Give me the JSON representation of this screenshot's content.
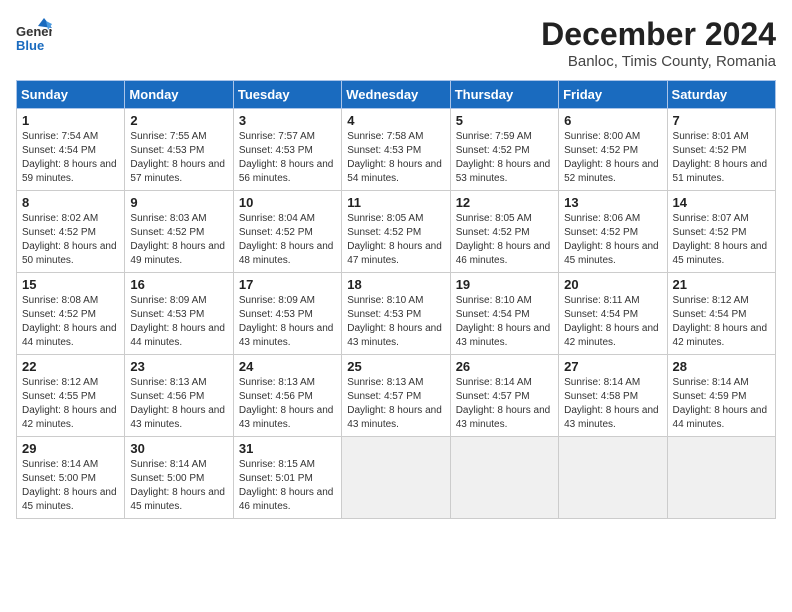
{
  "header": {
    "logo": {
      "line1": "General",
      "line2": "Blue"
    },
    "title": "December 2024",
    "subtitle": "Banloc, Timis County, Romania"
  },
  "weekdays": [
    "Sunday",
    "Monday",
    "Tuesday",
    "Wednesday",
    "Thursday",
    "Friday",
    "Saturday"
  ],
  "weeks": [
    [
      {
        "day": "1",
        "sunrise": "7:54 AM",
        "sunset": "4:54 PM",
        "daylight": "8 hours and 59 minutes."
      },
      {
        "day": "2",
        "sunrise": "7:55 AM",
        "sunset": "4:53 PM",
        "daylight": "8 hours and 57 minutes."
      },
      {
        "day": "3",
        "sunrise": "7:57 AM",
        "sunset": "4:53 PM",
        "daylight": "8 hours and 56 minutes."
      },
      {
        "day": "4",
        "sunrise": "7:58 AM",
        "sunset": "4:53 PM",
        "daylight": "8 hours and 54 minutes."
      },
      {
        "day": "5",
        "sunrise": "7:59 AM",
        "sunset": "4:52 PM",
        "daylight": "8 hours and 53 minutes."
      },
      {
        "day": "6",
        "sunrise": "8:00 AM",
        "sunset": "4:52 PM",
        "daylight": "8 hours and 52 minutes."
      },
      {
        "day": "7",
        "sunrise": "8:01 AM",
        "sunset": "4:52 PM",
        "daylight": "8 hours and 51 minutes."
      }
    ],
    [
      {
        "day": "8",
        "sunrise": "8:02 AM",
        "sunset": "4:52 PM",
        "daylight": "8 hours and 50 minutes."
      },
      {
        "day": "9",
        "sunrise": "8:03 AM",
        "sunset": "4:52 PM",
        "daylight": "8 hours and 49 minutes."
      },
      {
        "day": "10",
        "sunrise": "8:04 AM",
        "sunset": "4:52 PM",
        "daylight": "8 hours and 48 minutes."
      },
      {
        "day": "11",
        "sunrise": "8:05 AM",
        "sunset": "4:52 PM",
        "daylight": "8 hours and 47 minutes."
      },
      {
        "day": "12",
        "sunrise": "8:05 AM",
        "sunset": "4:52 PM",
        "daylight": "8 hours and 46 minutes."
      },
      {
        "day": "13",
        "sunrise": "8:06 AM",
        "sunset": "4:52 PM",
        "daylight": "8 hours and 45 minutes."
      },
      {
        "day": "14",
        "sunrise": "8:07 AM",
        "sunset": "4:52 PM",
        "daylight": "8 hours and 45 minutes."
      }
    ],
    [
      {
        "day": "15",
        "sunrise": "8:08 AM",
        "sunset": "4:52 PM",
        "daylight": "8 hours and 44 minutes."
      },
      {
        "day": "16",
        "sunrise": "8:09 AM",
        "sunset": "4:53 PM",
        "daylight": "8 hours and 44 minutes."
      },
      {
        "day": "17",
        "sunrise": "8:09 AM",
        "sunset": "4:53 PM",
        "daylight": "8 hours and 43 minutes."
      },
      {
        "day": "18",
        "sunrise": "8:10 AM",
        "sunset": "4:53 PM",
        "daylight": "8 hours and 43 minutes."
      },
      {
        "day": "19",
        "sunrise": "8:10 AM",
        "sunset": "4:54 PM",
        "daylight": "8 hours and 43 minutes."
      },
      {
        "day": "20",
        "sunrise": "8:11 AM",
        "sunset": "4:54 PM",
        "daylight": "8 hours and 42 minutes."
      },
      {
        "day": "21",
        "sunrise": "8:12 AM",
        "sunset": "4:54 PM",
        "daylight": "8 hours and 42 minutes."
      }
    ],
    [
      {
        "day": "22",
        "sunrise": "8:12 AM",
        "sunset": "4:55 PM",
        "daylight": "8 hours and 42 minutes."
      },
      {
        "day": "23",
        "sunrise": "8:13 AM",
        "sunset": "4:56 PM",
        "daylight": "8 hours and 43 minutes."
      },
      {
        "day": "24",
        "sunrise": "8:13 AM",
        "sunset": "4:56 PM",
        "daylight": "8 hours and 43 minutes."
      },
      {
        "day": "25",
        "sunrise": "8:13 AM",
        "sunset": "4:57 PM",
        "daylight": "8 hours and 43 minutes."
      },
      {
        "day": "26",
        "sunrise": "8:14 AM",
        "sunset": "4:57 PM",
        "daylight": "8 hours and 43 minutes."
      },
      {
        "day": "27",
        "sunrise": "8:14 AM",
        "sunset": "4:58 PM",
        "daylight": "8 hours and 43 minutes."
      },
      {
        "day": "28",
        "sunrise": "8:14 AM",
        "sunset": "4:59 PM",
        "daylight": "8 hours and 44 minutes."
      }
    ],
    [
      {
        "day": "29",
        "sunrise": "8:14 AM",
        "sunset": "5:00 PM",
        "daylight": "8 hours and 45 minutes."
      },
      {
        "day": "30",
        "sunrise": "8:14 AM",
        "sunset": "5:00 PM",
        "daylight": "8 hours and 45 minutes."
      },
      {
        "day": "31",
        "sunrise": "8:15 AM",
        "sunset": "5:01 PM",
        "daylight": "8 hours and 46 minutes."
      },
      null,
      null,
      null,
      null
    ]
  ]
}
